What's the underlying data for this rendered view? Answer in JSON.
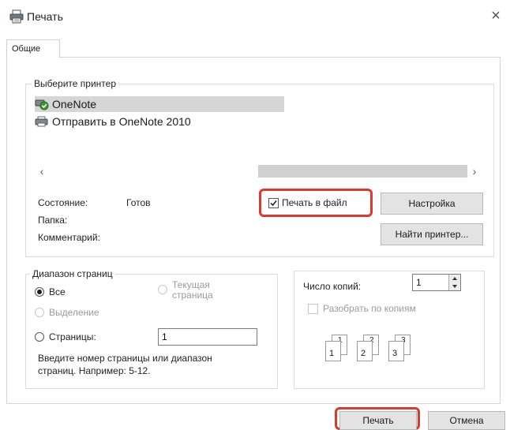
{
  "window": {
    "title": "Печать",
    "close_symbol": "×",
    "icon": "printer-icon"
  },
  "tabs": [
    {
      "label": "Общие"
    }
  ],
  "printer_group": {
    "legend": "Выберите принтер",
    "printers": [
      {
        "label": "OneNote",
        "selected": true,
        "icon": "printer-default-icon"
      },
      {
        "label": "Отправить в OneNote 2010",
        "selected": false,
        "icon": "printer-icon"
      }
    ],
    "scroll_left": "‹",
    "scroll_right": "›"
  },
  "status": {
    "state_label": "Состояние:",
    "state_value": "Готов",
    "folder_label": "Папка:",
    "comment_label": "Комментарий:",
    "print_to_file_label": "Печать в файл",
    "print_to_file_checked": true,
    "settings_button": "Настройка",
    "find_printer_button": "Найти принтер..."
  },
  "page_range": {
    "legend": "Диапазон страниц",
    "all_label": "Все",
    "current_label_line1": "Текущая",
    "current_label_line2": "страница",
    "selection_label": "Выделение",
    "pages_label": "Страницы:",
    "pages_value": "1",
    "hint_line1": "Введите номер страницы или диапазон",
    "hint_line2": "страниц. Например: 5-12."
  },
  "copies": {
    "label": "Число копий:",
    "value": "1",
    "collate_label": "Разобрать по копиям",
    "collate_icon_labels": [
      "1",
      "1",
      "2",
      "2",
      "3",
      "3"
    ]
  },
  "actions": {
    "print_button": "Печать",
    "cancel_button": "Отмена"
  },
  "colors": {
    "highlight": "#d93a2b",
    "selection": "#d6d6d6",
    "checkmark_green": "#3a9a2a"
  }
}
